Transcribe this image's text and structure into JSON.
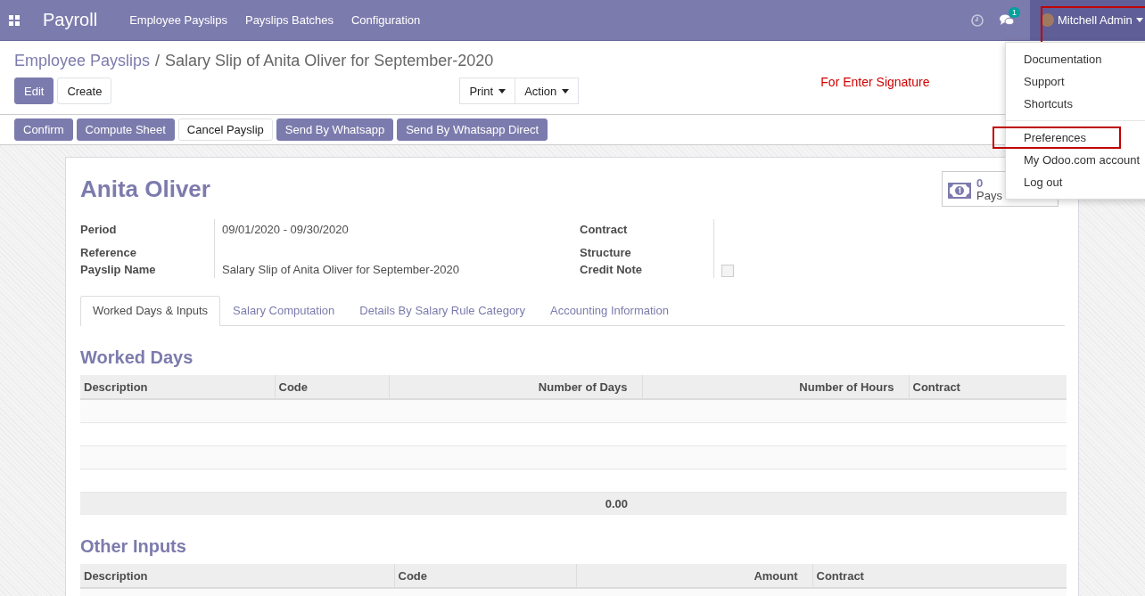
{
  "navbar": {
    "app_title": "Payroll",
    "menu": [
      "Employee Payslips",
      "Payslips Batches",
      "Configuration"
    ],
    "messages_badge": "1",
    "user_name": "Mitchell Admin",
    "user_highlighted": true
  },
  "breadcrumb": {
    "parent": "Employee Payslips",
    "separator": "/",
    "current": "Salary Slip of Anita Oliver for September-2020"
  },
  "buttons": [
    {
      "label": "Edit",
      "kind": "primary"
    },
    {
      "label": "Create",
      "kind": "secondary"
    }
  ],
  "dropdown_buttons": [
    "Print",
    "Action"
  ],
  "note": "For Enter Signature",
  "status_buttons": [
    {
      "label": "Confirm",
      "kind": "primary"
    },
    {
      "label": "Compute Sheet",
      "kind": "primary"
    },
    {
      "label": "Cancel Payslip",
      "kind": "secondary"
    },
    {
      "label": "Send By Whatsapp",
      "kind": "primary"
    },
    {
      "label": "Send By Whatsapp Direct",
      "kind": "primary"
    }
  ],
  "stat_button": {
    "value": "0",
    "label": "Pays"
  },
  "employee_name": "Anita Oliver",
  "fields_left": [
    {
      "label": "Period",
      "value": "09/01/2020 - 09/30/2020"
    },
    {
      "label": "Reference"
    },
    {
      "label": "Payslip Name",
      "value": "Salary Slip of Anita Oliver for September-2020"
    }
  ],
  "fields_right": [
    {
      "label": "Contract",
      "kind": "text"
    },
    {
      "label": "Structure",
      "kind": "text"
    },
    {
      "label": "Credit Note",
      "kind": "checkbox",
      "checked": false
    }
  ],
  "tabs": [
    {
      "label": "Worked Days & Inputs",
      "selected": true
    },
    {
      "label": "Salary Computation",
      "selected": false
    },
    {
      "label": "Details By Salary Rule Category",
      "selected": false
    },
    {
      "label": "Accounting Information",
      "selected": false
    }
  ],
  "worked_days": {
    "title": "Worked Days",
    "columns": [
      {
        "label": "Description",
        "numeric": false
      },
      {
        "label": "Code",
        "numeric": false
      },
      {
        "label": "Number of Days",
        "numeric": true,
        "total": "0.00"
      },
      {
        "label": "Number of Hours",
        "numeric": true
      },
      {
        "label": "Contract",
        "numeric": false
      }
    ]
  },
  "other_inputs": {
    "title": "Other Inputs",
    "columns": [
      {
        "label": "Description",
        "numeric": false
      },
      {
        "label": "Code",
        "numeric": false
      },
      {
        "label": "Amount",
        "numeric": true
      },
      {
        "label": "Contract",
        "numeric": false
      }
    ]
  },
  "user_menu": {
    "groups": [
      [
        {
          "label": "Documentation",
          "highlighted": false
        },
        {
          "label": "Support",
          "highlighted": false
        },
        {
          "label": "Shortcuts",
          "highlighted": false
        }
      ],
      [
        {
          "label": "Preferences",
          "highlighted": true
        },
        {
          "label": "My Odoo.com account",
          "highlighted": false
        },
        {
          "label": "Log out",
          "highlighted": false
        }
      ]
    ]
  }
}
